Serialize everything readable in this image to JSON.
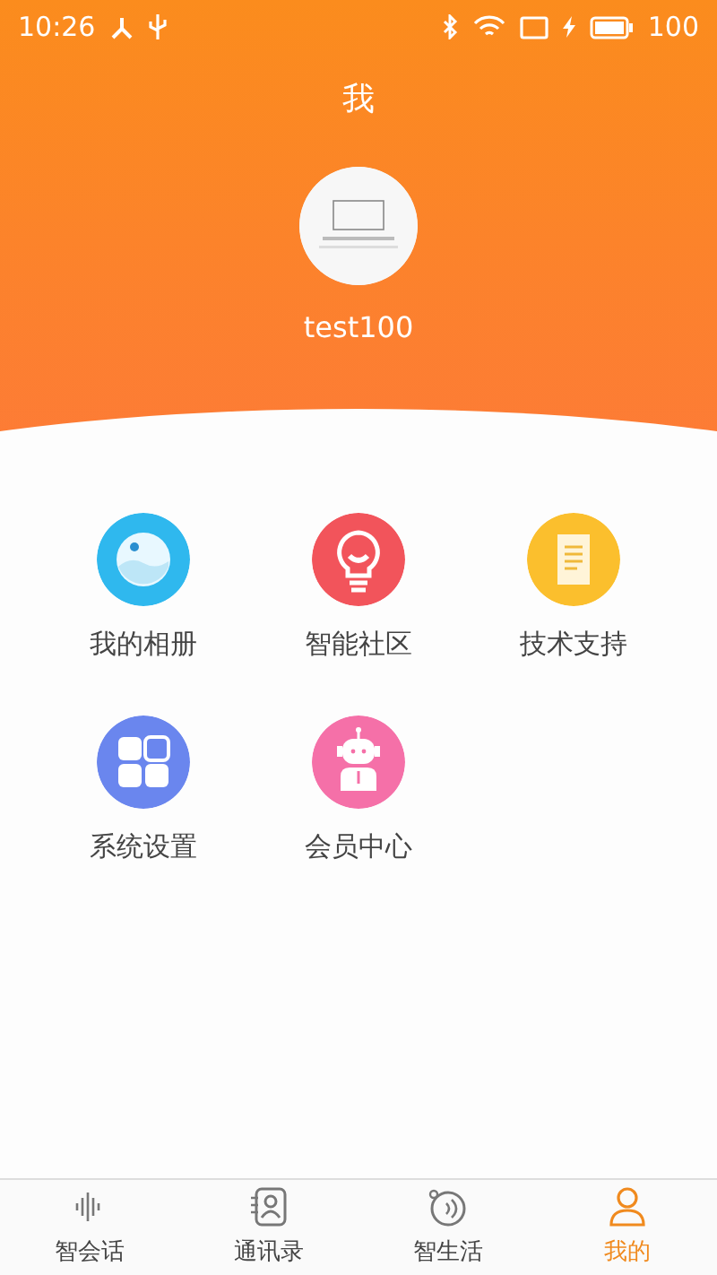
{
  "status_bar": {
    "time": "10:26",
    "battery": "100"
  },
  "header": {
    "title": "我",
    "username": "test100"
  },
  "menu": [
    {
      "label": "我的相册",
      "kind": "album",
      "color": "#2fb8ee"
    },
    {
      "label": "智能社区",
      "kind": "bulb",
      "color": "#f2545b"
    },
    {
      "label": "技术支持",
      "kind": "doc",
      "color": "#fbbf2d"
    },
    {
      "label": "系统设置",
      "kind": "grid",
      "color": "#6a86ee"
    },
    {
      "label": "会员中心",
      "kind": "robot",
      "color": "#f570a8"
    }
  ],
  "tabs": [
    {
      "label": "智会话",
      "kind": "voice",
      "selected": false
    },
    {
      "label": "通讯录",
      "kind": "contacts",
      "selected": false
    },
    {
      "label": "智生活",
      "kind": "life",
      "selected": false
    },
    {
      "label": "我的",
      "kind": "me",
      "selected": true
    }
  ]
}
